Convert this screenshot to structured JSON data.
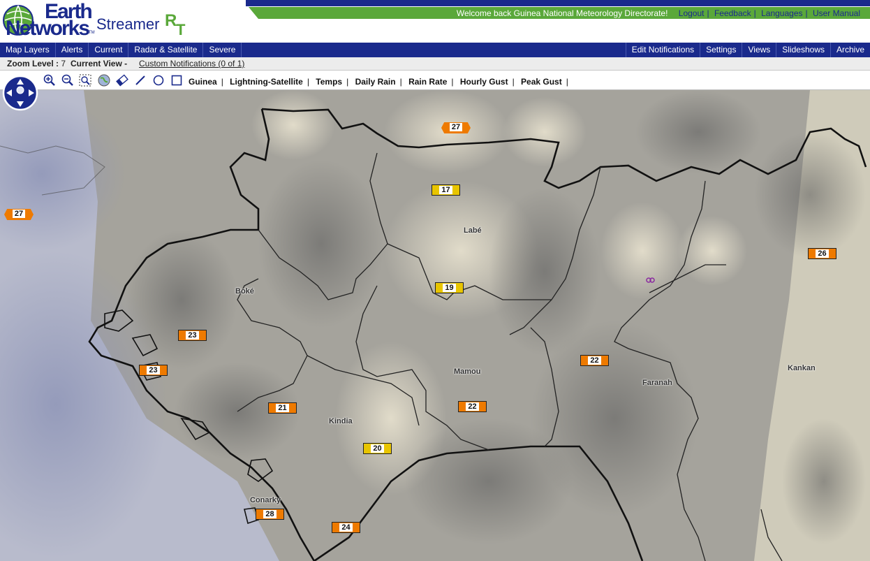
{
  "brand": {
    "logo_line1": "Earth",
    "logo_line2": "Networks",
    "logo_tm": "TM",
    "product": "Streamer",
    "product_suffix_r": "R",
    "product_suffix_t": "T",
    "colors": {
      "blue": "#1a2a8c",
      "green": "#5aa83a"
    }
  },
  "header": {
    "welcome": "Welcome back  Guinea National Meteorology Directorate!",
    "links": [
      "Logout",
      "Feedback",
      "Languages",
      "User Manual"
    ]
  },
  "menu": {
    "left": [
      "Map Layers",
      "Alerts",
      "Current",
      "Radar & Satellite",
      "Severe"
    ],
    "right": [
      "Edit Notifications",
      "Settings",
      "Views",
      "Slideshows",
      "Archive"
    ]
  },
  "status": {
    "zoom_label": "Zoom Level :",
    "zoom_value": "7",
    "view_label": "Current View -",
    "custom_notifications": "Custom Notifications (0 of 1)"
  },
  "toolbar": {
    "tools": [
      "zoom-in-icon",
      "zoom-out-icon",
      "zoom-box-icon",
      "globe-icon",
      "eraser-icon",
      "draw-line-icon",
      "draw-circle-icon",
      "draw-rectangle-icon"
    ],
    "layers": [
      "Guinea",
      "Lightning-Satellite",
      "Temps",
      "Daily Rain",
      "Rain Rate",
      "Hourly Gust",
      "Peak Gust"
    ]
  },
  "map": {
    "cities": [
      "Labé",
      "Boké",
      "Mamou",
      "Kindia",
      "Faranah",
      "Kankan",
      "Conarky"
    ],
    "stations": [
      "27",
      "27",
      "17",
      "26",
      "19",
      "23",
      "23",
      "22",
      "21",
      "22",
      "20",
      "28",
      "24"
    ]
  }
}
